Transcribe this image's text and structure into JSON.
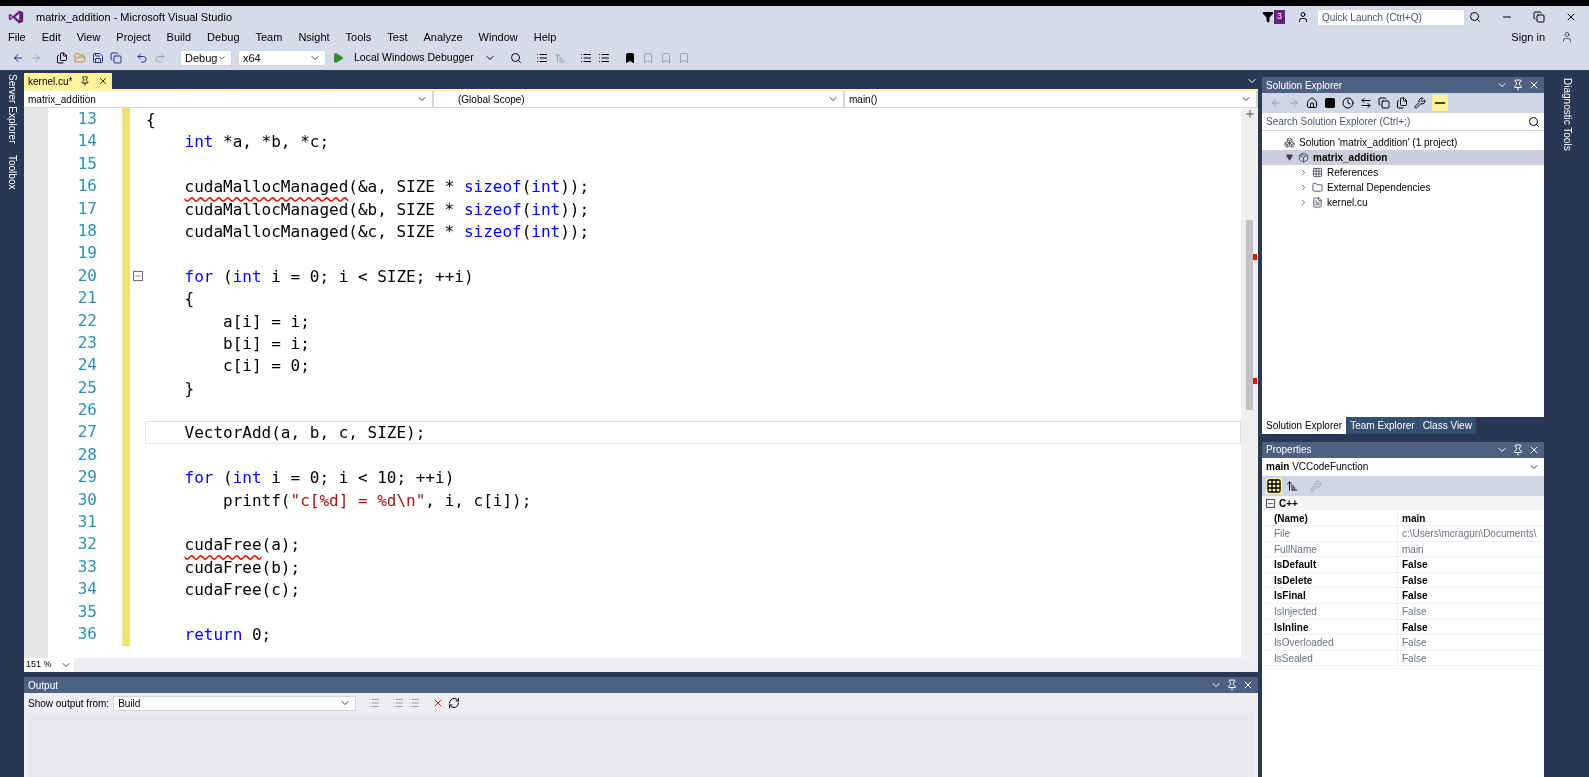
{
  "window": {
    "title": "matrix_addition - Microsoft Visual Studio",
    "notification_count": "3",
    "quick_launch": {
      "placeholder": "Quick Launch (Ctrl+Q)"
    },
    "sign_in": "Sign in"
  },
  "menu": [
    "File",
    "Edit",
    "View",
    "Project",
    "Build",
    "Debug",
    "Team",
    "Nsight",
    "Tools",
    "Test",
    "Analyze",
    "Window",
    "Help"
  ],
  "toolbar": {
    "configuration": "Debug",
    "platform": "x64",
    "run": "Local Windows Debugger"
  },
  "side_tabs_left": [
    "Server Explorer",
    "Toolbox"
  ],
  "side_tabs_right": [
    "Diagnostic Tools"
  ],
  "editor": {
    "tabs": [
      {
        "label": "kernel.cu*",
        "selected": true
      }
    ],
    "nav": [
      "matrix_addition",
      "(Global Scope)",
      "main()"
    ],
    "zoom": "151 %",
    "lines": [
      {
        "number": "13",
        "current": false,
        "collapsible": false,
        "tokens": [
          {
            "kind": "plain",
            "text": "{"
          }
        ]
      },
      {
        "number": "14",
        "current": false,
        "collapsible": false,
        "tokens": [
          {
            "kind": "keyword",
            "text": "    int"
          },
          {
            "kind": "plain",
            "text": " *a, *b, *c;"
          }
        ]
      },
      {
        "number": "15",
        "current": false,
        "collapsible": false
      },
      {
        "number": "16",
        "current": false,
        "collapsible": false,
        "tokens": [
          {
            "kind": "error",
            "text": "    cudaMallocManaged"
          },
          {
            "kind": "plain",
            "text": "(&a, SIZE * "
          },
          {
            "kind": "keyword",
            "text": "sizeof"
          },
          {
            "kind": "plain",
            "text": "("
          },
          {
            "kind": "keyword",
            "text": "int"
          },
          {
            "kind": "plain",
            "text": "));"
          }
        ]
      },
      {
        "number": "17",
        "current": false,
        "collapsible": false,
        "tokens": [
          {
            "kind": "plain",
            "text": "    cudaMallocManaged(&b, SIZE * "
          },
          {
            "kind": "keyword",
            "text": "sizeof"
          },
          {
            "kind": "plain",
            "text": "("
          },
          {
            "kind": "keyword",
            "text": "int"
          },
          {
            "kind": "plain",
            "text": "));"
          }
        ]
      },
      {
        "number": "18",
        "current": false,
        "collapsible": false,
        "tokens": [
          {
            "kind": "plain",
            "text": "    cudaMallocManaged(&c, SIZE * "
          },
          {
            "kind": "keyword",
            "text": "sizeof"
          },
          {
            "kind": "plain",
            "text": "("
          },
          {
            "kind": "keyword",
            "text": "int"
          },
          {
            "kind": "plain",
            "text": "));"
          }
        ]
      },
      {
        "number": "19",
        "current": false,
        "collapsible": false
      },
      {
        "number": "20",
        "current": false,
        "collapsible": true,
        "tokens": [
          {
            "kind": "keyword",
            "text": "    for"
          },
          {
            "kind": "plain",
            "text": " ("
          },
          {
            "kind": "keyword",
            "text": "int"
          },
          {
            "kind": "plain",
            "text": " i = 0; i < SIZE; ++i)"
          }
        ]
      },
      {
        "number": "21",
        "current": false,
        "collapsible": false,
        "tokens": [
          {
            "kind": "plain",
            "text": "    {"
          }
        ]
      },
      {
        "number": "22",
        "current": false,
        "collapsible": false,
        "tokens": [
          {
            "kind": "plain",
            "text": "        a[i] = i;"
          }
        ]
      },
      {
        "number": "23",
        "current": false,
        "collapsible": false,
        "tokens": [
          {
            "kind": "plain",
            "text": "        b[i] = i;"
          }
        ]
      },
      {
        "number": "24",
        "current": false,
        "collapsible": false,
        "tokens": [
          {
            "kind": "plain",
            "text": "        c[i] = 0;"
          }
        ]
      },
      {
        "number": "25",
        "current": false,
        "collapsible": false,
        "tokens": [
          {
            "kind": "plain",
            "text": "    }"
          }
        ]
      },
      {
        "number": "26",
        "current": false,
        "collapsible": false
      },
      {
        "number": "27",
        "current": true,
        "collapsible": false,
        "tokens": [
          {
            "kind": "plain",
            "text": "    VectorAdd(a, b, c, SIZE);"
          }
        ]
      },
      {
        "number": "28",
        "current": false,
        "collapsible": false
      },
      {
        "number": "29",
        "current": false,
        "collapsible": false,
        "tokens": [
          {
            "kind": "keyword",
            "text": "    for"
          },
          {
            "kind": "plain",
            "text": " ("
          },
          {
            "kind": "keyword",
            "text": "int"
          },
          {
            "kind": "plain",
            "text": " i = 0; i < 10; ++i)"
          }
        ]
      },
      {
        "number": "30",
        "current": false,
        "collapsible": false,
        "tokens": [
          {
            "kind": "plain",
            "text": "        printf("
          },
          {
            "kind": "string",
            "text": "\"c[%d] = %d\\n\""
          },
          {
            "kind": "plain",
            "text": ", i, c[i]);"
          }
        ]
      },
      {
        "number": "31",
        "current": false,
        "collapsible": false
      },
      {
        "number": "32",
        "current": false,
        "collapsible": false,
        "tokens": [
          {
            "kind": "error",
            "text": "    cudaFree"
          },
          {
            "kind": "plain",
            "text": "(a);"
          }
        ]
      },
      {
        "number": "33",
        "current": false,
        "collapsible": false,
        "tokens": [
          {
            "kind": "plain",
            "text": "    cudaFree(b);"
          }
        ]
      },
      {
        "number": "34",
        "current": false,
        "collapsible": false,
        "tokens": [
          {
            "kind": "plain",
            "text": "    cudaFree(c);"
          }
        ]
      },
      {
        "number": "35",
        "current": false,
        "collapsible": false
      },
      {
        "number": "36",
        "current": false,
        "collapsible": false,
        "tokens": [
          {
            "kind": "keyword",
            "text": "    return"
          },
          {
            "kind": "plain",
            "text": " 0;"
          }
        ]
      }
    ]
  },
  "solution_explorer": {
    "title": "Solution Explorer",
    "search": {
      "placeholder": "Search Solution Explorer (Ctrl+;)"
    },
    "tree": [
      {
        "label": "Solution 'matrix_addition' (1 project)",
        "kind": "solution",
        "selected": false,
        "children": [
          {
            "label": "matrix_addition",
            "kind": "project",
            "expanded": true,
            "selected": true,
            "children": [
              {
                "label": "References",
                "kind": "references",
                "expanded": false,
                "selected": false
              },
              {
                "label": "External Dependencies",
                "kind": "folder",
                "expanded": false,
                "selected": false
              },
              {
                "label": "kernel.cu",
                "kind": "file",
                "expanded": false,
                "selected": false
              }
            ]
          }
        ]
      }
    ],
    "tabs": [
      {
        "label": "Solution Explorer",
        "selected": true
      },
      {
        "label": "Team Explorer",
        "selected": false
      },
      {
        "label": "Class View",
        "selected": false
      }
    ]
  },
  "properties": {
    "title": "Properties",
    "object": "main",
    "object_type": "VCCodeFunction",
    "category": {
      "label": "C++",
      "expanded": true
    },
    "rows": [
      {
        "name": "(Name)",
        "value": "main",
        "disabled": false
      },
      {
        "name": "File",
        "value": "c:\\Users\\mcragun\\Documents\\",
        "disabled": true
      },
      {
        "name": "FullName",
        "value": "main",
        "disabled": true
      },
      {
        "name": "IsDefault",
        "value": "False",
        "disabled": false
      },
      {
        "name": "IsDelete",
        "value": "False",
        "disabled": false
      },
      {
        "name": "IsFinal",
        "value": "False",
        "disabled": false
      },
      {
        "name": "IsInjected",
        "value": "False",
        "disabled": true
      },
      {
        "name": "IsInline",
        "value": "False",
        "disabled": false
      },
      {
        "name": "IsOverloaded",
        "value": "False",
        "disabled": true
      },
      {
        "name": "IsSealed",
        "value": "False",
        "disabled": true
      }
    ]
  },
  "output": {
    "title": "Output",
    "label": "Show output from:",
    "source": "Build"
  }
}
